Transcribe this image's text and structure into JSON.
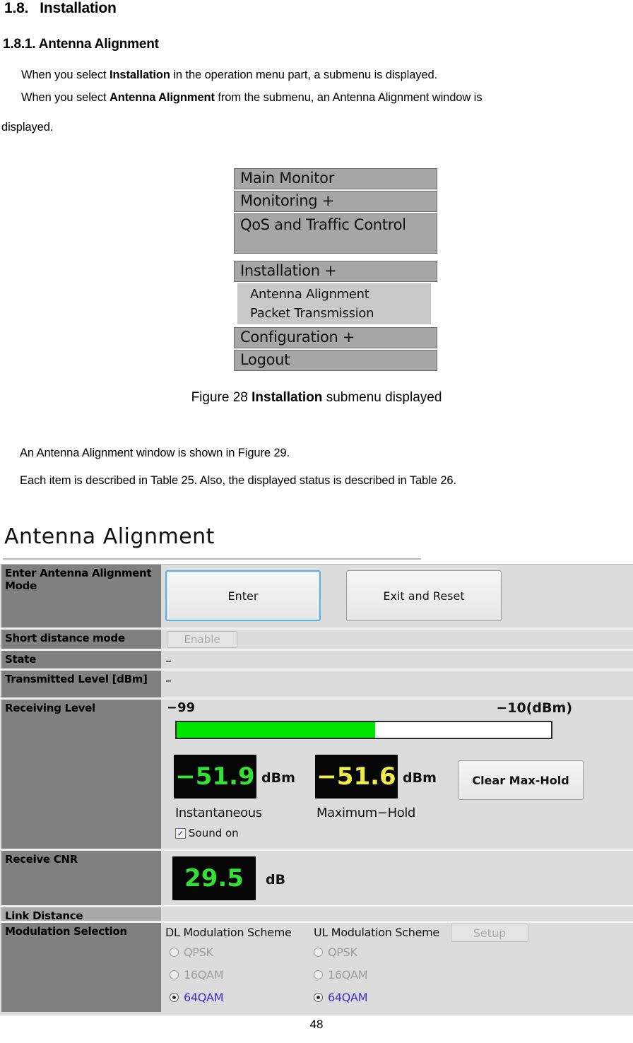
{
  "document": {
    "section_number": "1.8.",
    "section_title": "Installation",
    "subsection_title": "1.8.1. Antenna Alignment",
    "paragraph_1_pre": "When you select ",
    "paragraph_1_bold": "Installation",
    "paragraph_1_post": " in the operation menu part, a submenu is displayed.",
    "paragraph_2_pre": "When you select ",
    "paragraph_2_bold": "Antenna Alignment",
    "paragraph_2_post": " from the submenu, an Antenna Alignment window is",
    "paragraph_3": "displayed.",
    "paragraph_4": "An Antenna Alignment window is shown in Figure 29.",
    "paragraph_5": "Each item is described in Table 25. Also, the displayed status is described in Table 26.",
    "figure_caption_pre": "Figure 28 ",
    "figure_caption_bold": "Installation",
    "figure_caption_post": " submenu displayed",
    "page_number": "48"
  },
  "menu": {
    "items": [
      {
        "label": "Main Monitor"
      },
      {
        "label": "Monitoring +"
      },
      {
        "label": "QoS and Traffic Control"
      },
      {
        "label": "Installation +"
      },
      {
        "label": "Configuration +"
      },
      {
        "label": "Logout"
      }
    ],
    "submenu": {
      "item_1": "Antenna Alignment",
      "item_2": "Packet Transmission"
    }
  },
  "antenna_alignment": {
    "window_title": "Antenna Alignment",
    "rows": {
      "enter_mode_label": "Enter Antenna Alignment Mode",
      "enter_button": "Enter",
      "exit_button": "Exit and Reset",
      "short_distance_label": "Short distance mode",
      "short_distance_button": "Enable",
      "state_label": "State",
      "state_value": "–",
      "transmitted_level_label": "Transmitted Level [dBm]",
      "transmitted_level_value": "–",
      "receiving_level_label": "Receiving Level",
      "receive_cnr_label": "Receive CNR",
      "link_distance_label": "Link Distance",
      "link_distance_value": "",
      "modulation_label": "Modulation Selection"
    },
    "receiving_level": {
      "scale_min": "−99",
      "scale_max": "−10(dBm)",
      "bar_fill_percent": 53,
      "bar_fill_color": "#00e500",
      "instantaneous_value": "−51.9",
      "instantaneous_unit": "dBm",
      "instantaneous_color": "#33e033",
      "instantaneous_caption": "Instantaneous",
      "maxhold_value": "−51.6",
      "maxhold_unit": "dBm",
      "maxhold_color": "#eded4a",
      "maxhold_caption": "Maximum−Hold",
      "clear_button": "Clear Max-Hold",
      "sound_checkbox_label": "Sound on",
      "sound_checkbox_checked": true,
      "sound_checkbox_glyph": "✓"
    },
    "receive_cnr": {
      "value": "29.5",
      "unit": "dB",
      "color": "#33e033"
    },
    "modulation": {
      "dl_header": "DL Modulation Scheme",
      "ul_header": "UL Modulation Scheme",
      "setup_button": "Setup",
      "dl_options": [
        {
          "label": "QPSK",
          "selected": false
        },
        {
          "label": "16QAM",
          "selected": false
        },
        {
          "label": "64QAM",
          "selected": true
        }
      ],
      "ul_options": [
        {
          "label": "QPSK",
          "selected": false
        },
        {
          "label": "16QAM",
          "selected": false
        },
        {
          "label": "64QAM",
          "selected": true
        }
      ]
    }
  }
}
